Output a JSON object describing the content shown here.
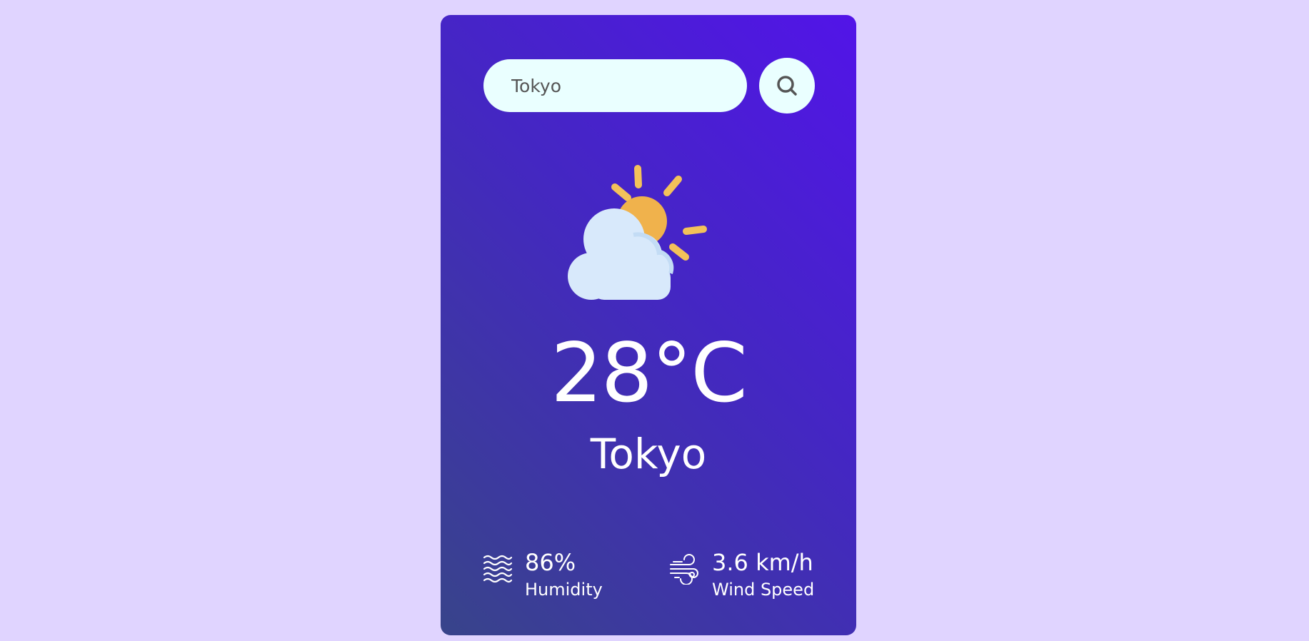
{
  "search": {
    "value": "Tokyo",
    "placeholder": "Tokyo"
  },
  "weather": {
    "icon": "partly-cloudy-icon",
    "temperature": "28°C",
    "city": "Tokyo"
  },
  "details": {
    "humidity": {
      "icon": "humidity-waves-icon",
      "value": "86%",
      "label": "Humidity"
    },
    "wind": {
      "icon": "wind-icon",
      "value": "3.6 km/h",
      "label": "Wind Speed"
    }
  },
  "colors": {
    "background": "#e0d4ff",
    "card_gradient_start": "#5214e8",
    "card_gradient_end": "#38448a",
    "input_background": "#eaffff",
    "sun": "#f0b24c",
    "sun_rays": "#f3c25a",
    "cloud": "#d8e9fb"
  }
}
